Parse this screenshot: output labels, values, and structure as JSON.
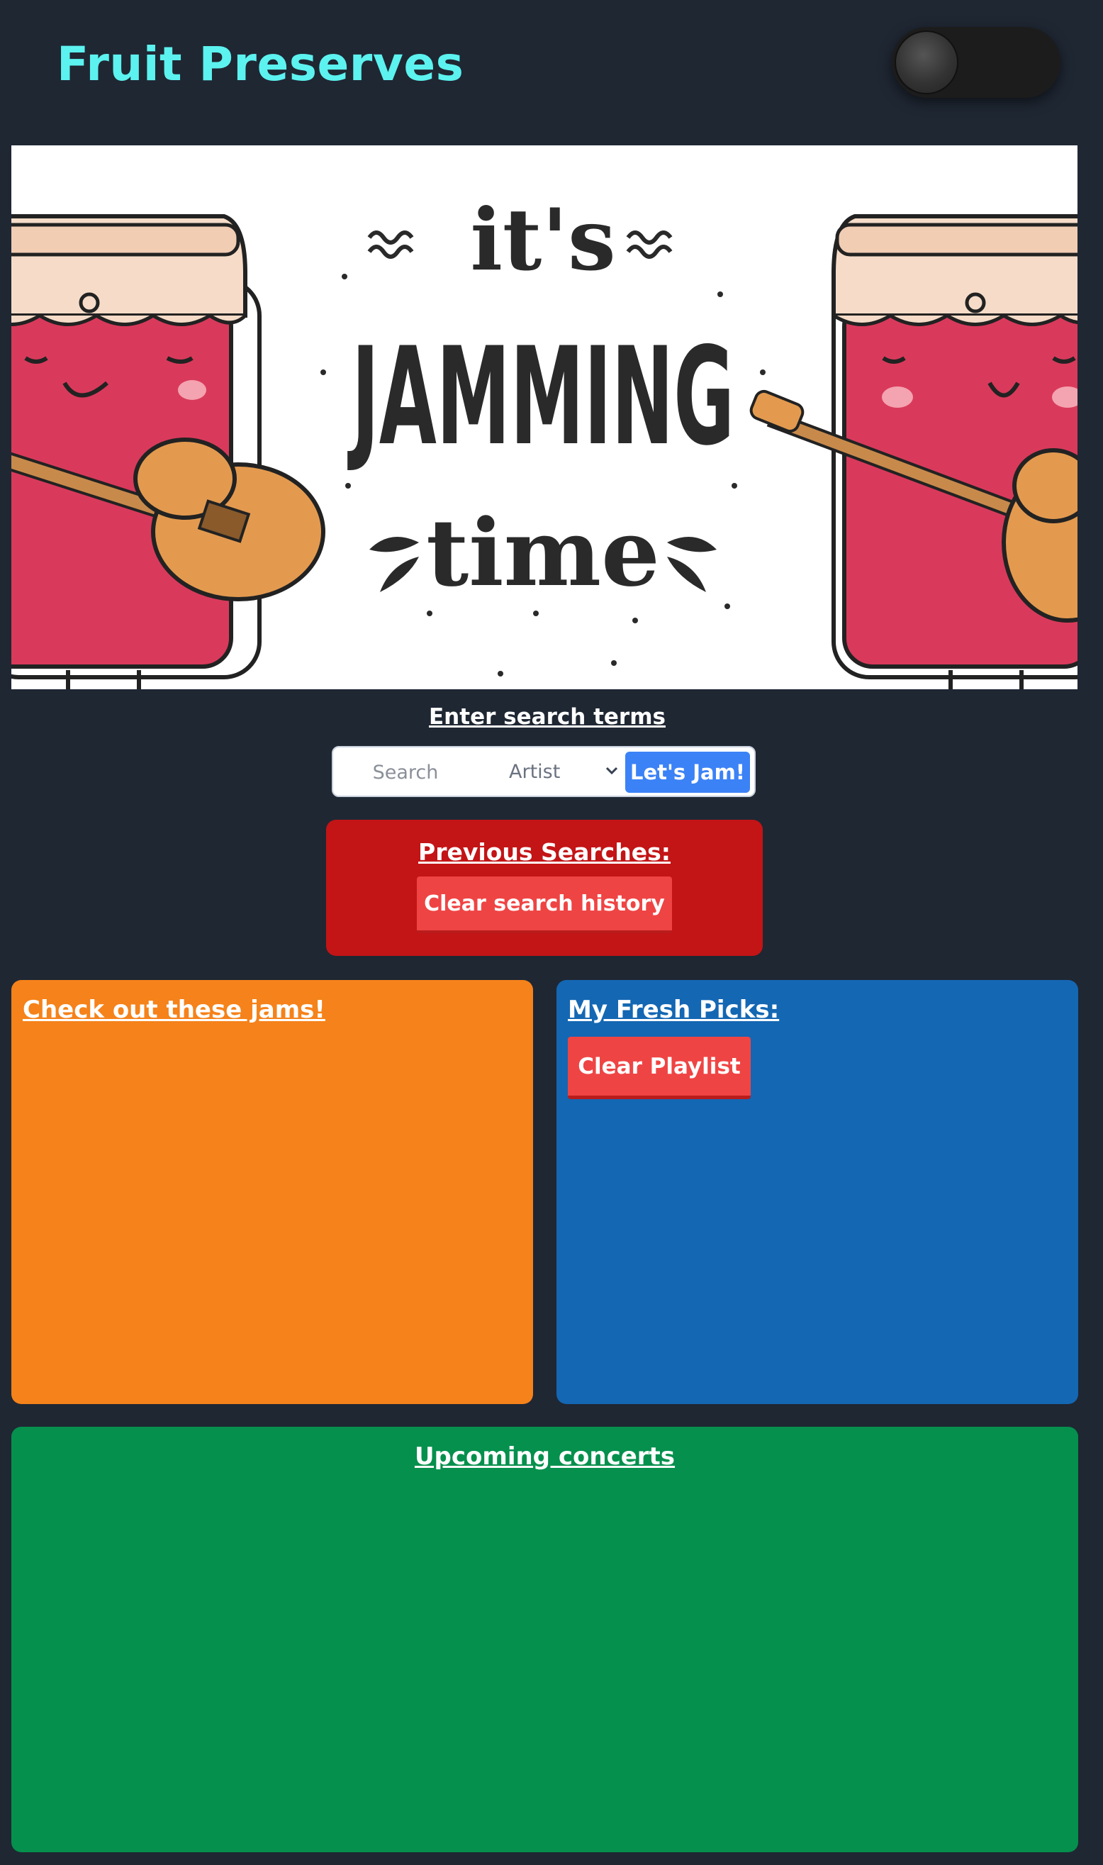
{
  "header": {
    "title": "Fruit Preserves",
    "theme_toggle": {
      "state": "off"
    }
  },
  "banner": {
    "line1": "it's",
    "line2": "JAMMING",
    "line3": "time"
  },
  "search": {
    "label": "Enter search terms",
    "input_placeholder": "Search",
    "input_value": "",
    "type_selected": "Artist",
    "submit_label": "Let's Jam!"
  },
  "previous_searches": {
    "title": "Previous Searches:",
    "clear_label": "Clear search history"
  },
  "jams_panel": {
    "title": "Check out these jams!",
    "color": "#f5821a"
  },
  "picks_panel": {
    "title": "My Fresh Picks:",
    "clear_label": "Clear Playlist",
    "color": "#1467b3"
  },
  "concerts_panel": {
    "title": "Upcoming concerts",
    "color": "#05904d"
  },
  "colors": {
    "background": "#1f2733",
    "title": "#5cf2ef",
    "accent_button": "#3b82f6",
    "danger_button": "#ef4444",
    "previous_box": "#c31416"
  }
}
